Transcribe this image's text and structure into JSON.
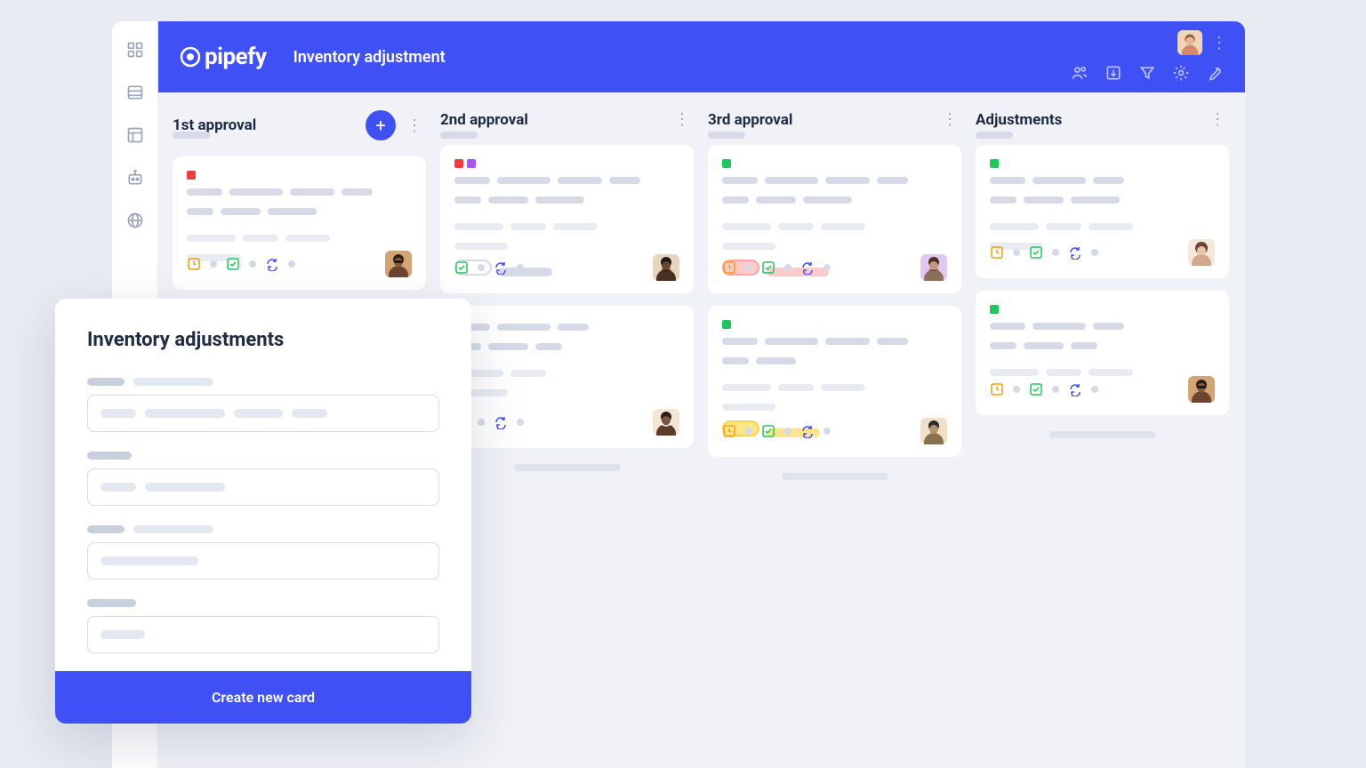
{
  "brand": "pipefy",
  "page_title": "Inventory adjustment",
  "sidebar": {
    "items": [
      {
        "name": "apps"
      },
      {
        "name": "list"
      },
      {
        "name": "layout"
      },
      {
        "name": "automation"
      },
      {
        "name": "globe"
      }
    ]
  },
  "header_tools": [
    {
      "name": "people"
    },
    {
      "name": "import"
    },
    {
      "name": "filter"
    },
    {
      "name": "settings"
    },
    {
      "name": "wrench"
    }
  ],
  "columns": [
    {
      "title": "1st approval",
      "has_add": true
    },
    {
      "title": "2nd approval",
      "has_add": false
    },
    {
      "title": "3rd approval",
      "has_add": false
    },
    {
      "title": "Adjustments",
      "has_add": false
    }
  ],
  "colors": {
    "primary": "#3f50f5",
    "red": "#f03d3d",
    "purple": "#a855f7",
    "green": "#22c55e"
  },
  "modal": {
    "title": "Inventory adjustments",
    "cta": "Create new card"
  }
}
